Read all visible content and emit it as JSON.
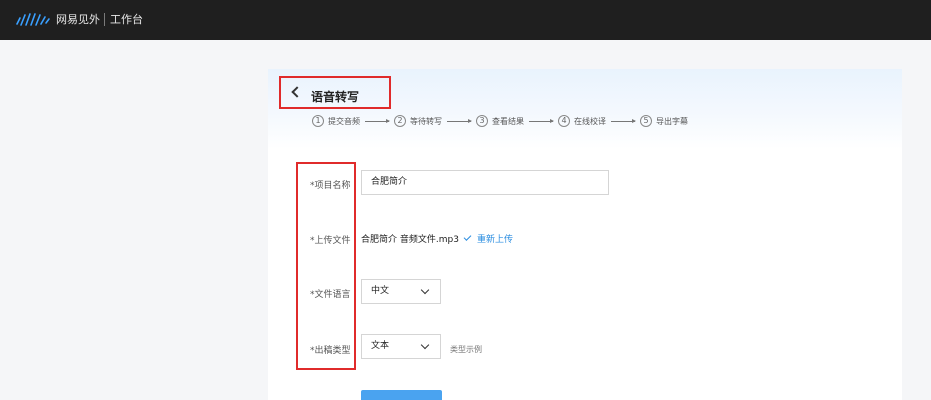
{
  "header": {
    "brand": "网易见外",
    "workspace": "工作台"
  },
  "page": {
    "back_title": "语音转写"
  },
  "steps": [
    {
      "num": "1",
      "label": "提交音频"
    },
    {
      "num": "2",
      "label": "等待转写"
    },
    {
      "num": "3",
      "label": "查看结果"
    },
    {
      "num": "4",
      "label": "在线校译"
    },
    {
      "num": "5",
      "label": "导出字幕"
    }
  ],
  "form": {
    "project_name": {
      "label": "*项目名称",
      "value": "合肥简介"
    },
    "upload": {
      "label": "*上传文件",
      "file_name": "合肥简介 音频文件.mp3",
      "reupload": "重新上传"
    },
    "language": {
      "label": "*文件语言",
      "value": "中文"
    },
    "output_type": {
      "label": "*出稿类型",
      "value": "文本",
      "example": "类型示例"
    }
  },
  "colors": {
    "topbar": "#1f1f1f",
    "accent": "#2a8de0",
    "highlight": "#e02b2b"
  },
  "icons": [
    "logo-icon",
    "back-arrow-icon",
    "check-icon",
    "chevron-down-icon"
  ]
}
